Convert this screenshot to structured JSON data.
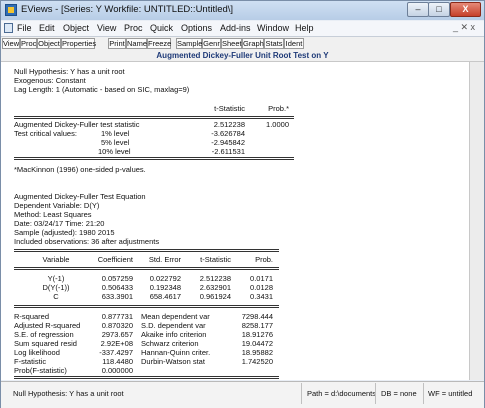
{
  "window": {
    "title": "EViews - [Series: Y   Workfile: UNTITLED::Untitled\\]"
  },
  "window_controls": {
    "minimize": "–",
    "maximize": "□",
    "close": "X"
  },
  "menu": [
    "File",
    "Edit",
    "Object",
    "View",
    "Proc",
    "Quick",
    "Options",
    "Add-ins",
    "Window",
    "Help"
  ],
  "mdi_controls": "_ ✕ x",
  "toolbar": [
    "View",
    "Proc",
    "Object",
    "Properties",
    "Print",
    "Name",
    "Freeze",
    "Sample",
    "Genr",
    "Sheet",
    "Graph",
    "Stats",
    "Ident"
  ],
  "heading": "Augmented Dickey-Fuller Unit Root Test on Y",
  "header_lines": [
    "Null Hypothesis: Y has a unit root",
    "Exogenous: Constant",
    "Lag Length: 1 (Automatic - based on SIC, maxlag=9)"
  ],
  "adf_table": {
    "col1": "t-Statistic",
    "col2": "Prob.*",
    "stat_label": "Augmented Dickey-Fuller test statistic",
    "stat_value": "2.512238",
    "stat_prob": "1.0000",
    "crit_label": "Test critical values:",
    "crit": [
      {
        "level": "1% level",
        "value": "-3.626784"
      },
      {
        "level": "5% level",
        "value": "-2.945842"
      },
      {
        "level": "10% level",
        "value": "-2.611531"
      }
    ]
  },
  "footnote": "*MacKinnon (1996) one-sided p-values.",
  "equation_lines": [
    "Augmented Dickey-Fuller Test Equation",
    "Dependent Variable: D(Y)",
    "Method: Least Squares",
    "Date: 03/24/17   Time: 21:20",
    "Sample (adjusted): 1980 2015",
    "Included observations: 36 after adjustments"
  ],
  "coef_table": {
    "headers": [
      "Variable",
      "Coefficient",
      "Std. Error",
      "t-Statistic",
      "Prob."
    ],
    "rows": [
      [
        "Y(-1)",
        "0.057259",
        "0.022792",
        "2.512238",
        "0.0171"
      ],
      [
        "D(Y(-1))",
        "0.506433",
        "0.192348",
        "2.632901",
        "0.0128"
      ],
      [
        "C",
        "633.3901",
        "658.4617",
        "0.961924",
        "0.3431"
      ]
    ]
  },
  "stats": [
    {
      "l1": "R-squared",
      "v1": "0.877731",
      "l2": "Mean dependent var",
      "v2": "7298.444"
    },
    {
      "l1": "Adjusted R-squared",
      "v1": "0.870320",
      "l2": "S.D. dependent var",
      "v2": "8258.177"
    },
    {
      "l1": "S.E. of regression",
      "v1": "2973.657",
      "l2": "Akaike info criterion",
      "v2": "18.91276"
    },
    {
      "l1": "Sum squared resid",
      "v1": "2.92E+08",
      "l2": "Schwarz criterion",
      "v2": "19.04472"
    },
    {
      "l1": "Log likelihood",
      "v1": "-337.4297",
      "l2": "Hannan-Quinn criter.",
      "v2": "18.95882"
    },
    {
      "l1": "F-statistic",
      "v1": "118.4480",
      "l2": "Durbin-Watson stat",
      "v2": "1.742520"
    },
    {
      "l1": "Prob(F-statistic)",
      "v1": "0.000000",
      "l2": "",
      "v2": ""
    }
  ],
  "status": {
    "message": "Null Hypothesis: Y has a unit root",
    "path": "Path = d:\\documents",
    "db": "DB = none",
    "wf": "WF = untitled"
  }
}
